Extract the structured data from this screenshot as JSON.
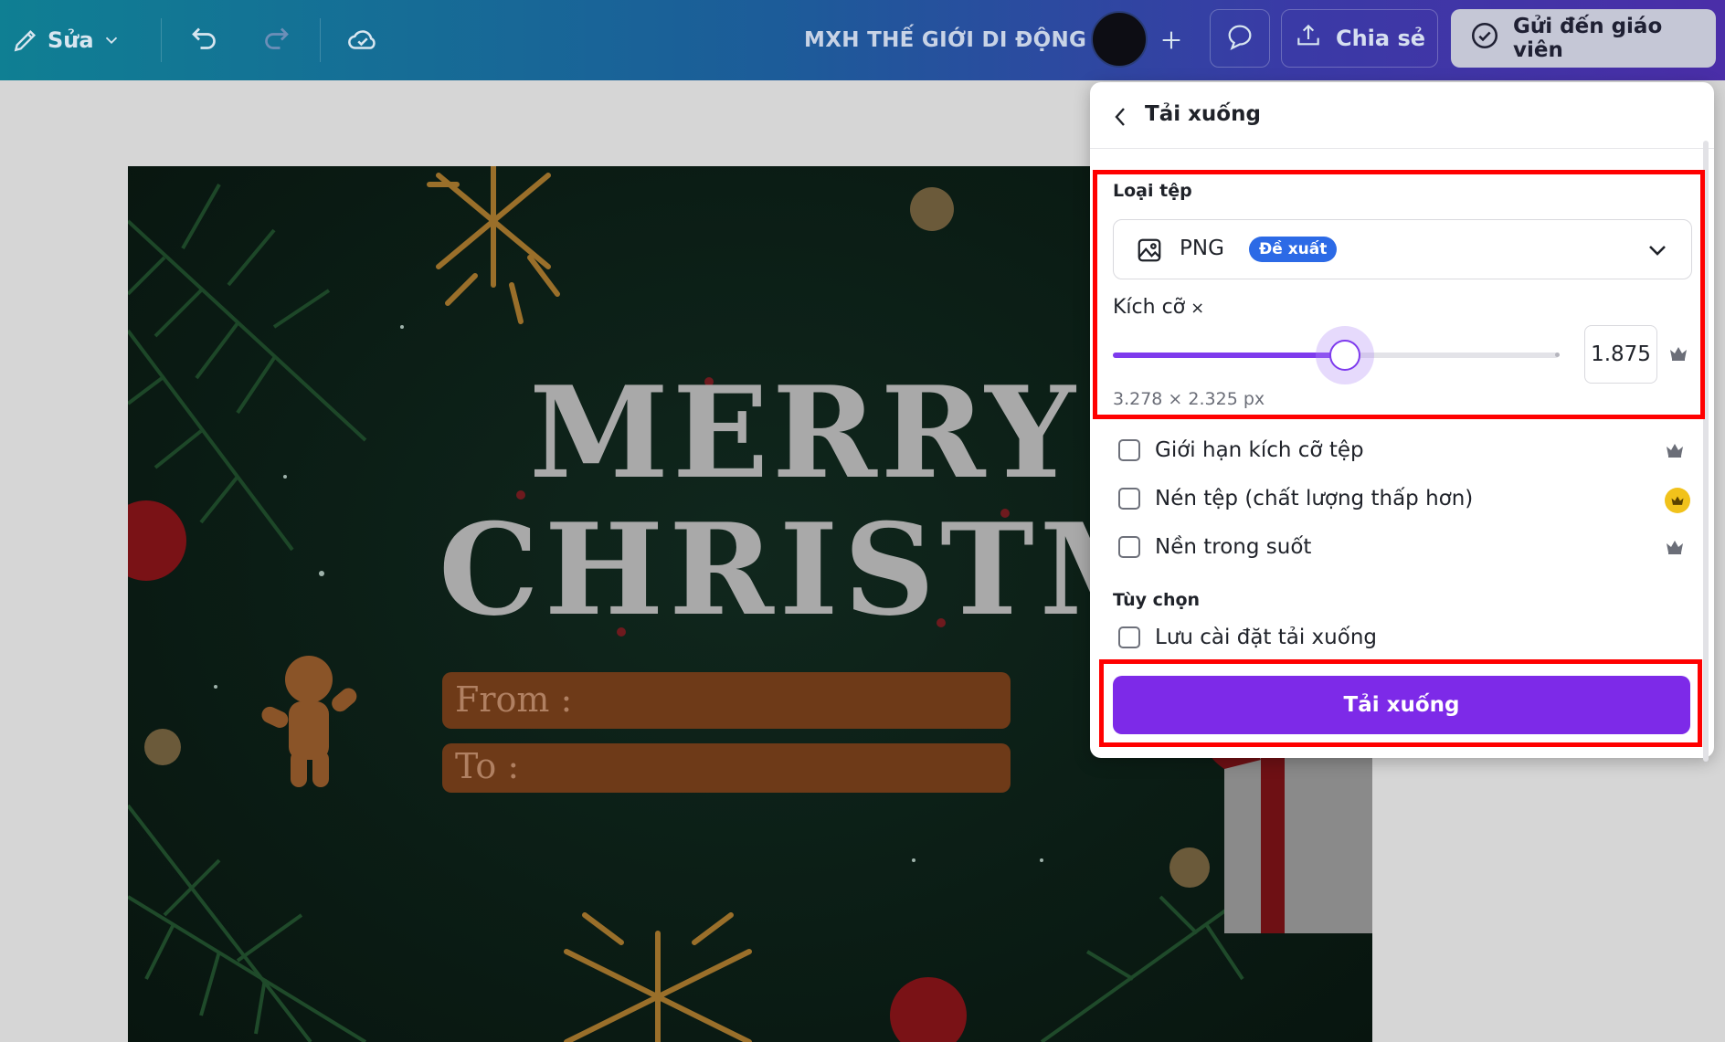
{
  "topbar": {
    "edit_label": "Sửa",
    "doc_title": "MXH THẾ GIỚI DI ĐỘNG",
    "share_label": "Chia sẻ",
    "send_label": "Gửi đến giáo viên"
  },
  "card": {
    "greeting_line1": "MERRY",
    "greeting_line2": "CHRISTMAS",
    "from_label": "From :",
    "to_label": "To :"
  },
  "panel": {
    "title": "Tải xuống",
    "file_type_label": "Loại tệp",
    "file_type_value": "PNG",
    "file_type_badge": "Đề xuất",
    "size_label": "Kích cỡ",
    "size_symbol": "×",
    "size_value": "1.875",
    "size_slider_fraction": 0.52,
    "dimensions": "3.278 × 2.325 px",
    "options": [
      {
        "label": "Giới hạn kích cỡ tệp",
        "checked": false
      },
      {
        "label": "Nén tệp (chất lượng thấp hơn)",
        "checked": false
      },
      {
        "label": "Nền trong suốt",
        "checked": false
      }
    ],
    "options_section_label": "Tùy chọn",
    "save_settings_label": "Lưu cài đặt tải xuống",
    "download_button": "Tải xuống"
  },
  "colors": {
    "accent": "#7d2ae8",
    "badge": "#2c6ae6",
    "highlight": "#ff0000",
    "crown_gold": "#f1c21b"
  }
}
